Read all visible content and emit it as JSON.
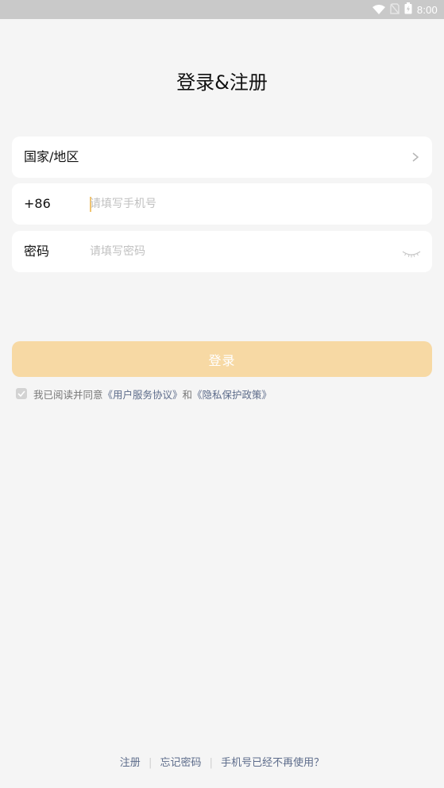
{
  "status_bar": {
    "time": "8:00",
    "icons": [
      "wifi-icon",
      "no-sim-icon",
      "battery-charging-icon"
    ]
  },
  "page": {
    "title": "登录&注册"
  },
  "form": {
    "region_label": "国家/地区",
    "phone_prefix": "+86",
    "phone_placeholder": "请填写手机号",
    "phone_value": "",
    "password_label": "密码",
    "password_placeholder": "请填写密码",
    "password_value": ""
  },
  "login_button": {
    "label": "登录"
  },
  "agreement": {
    "checked": true,
    "prefix": "我已阅读并同意",
    "terms_link": "《用户服务协议》",
    "conjunction": "和",
    "privacy_link": "《隐私保护政策》"
  },
  "footer": {
    "register": "注册",
    "forgot_password": "忘记密码",
    "phone_unavailable": "手机号已经不再使用？",
    "separator": "|"
  },
  "colors": {
    "accent": "#f7d9a4",
    "link": "#5c6b8a",
    "background": "#f5f5f5",
    "caret": "#f1c46f"
  }
}
